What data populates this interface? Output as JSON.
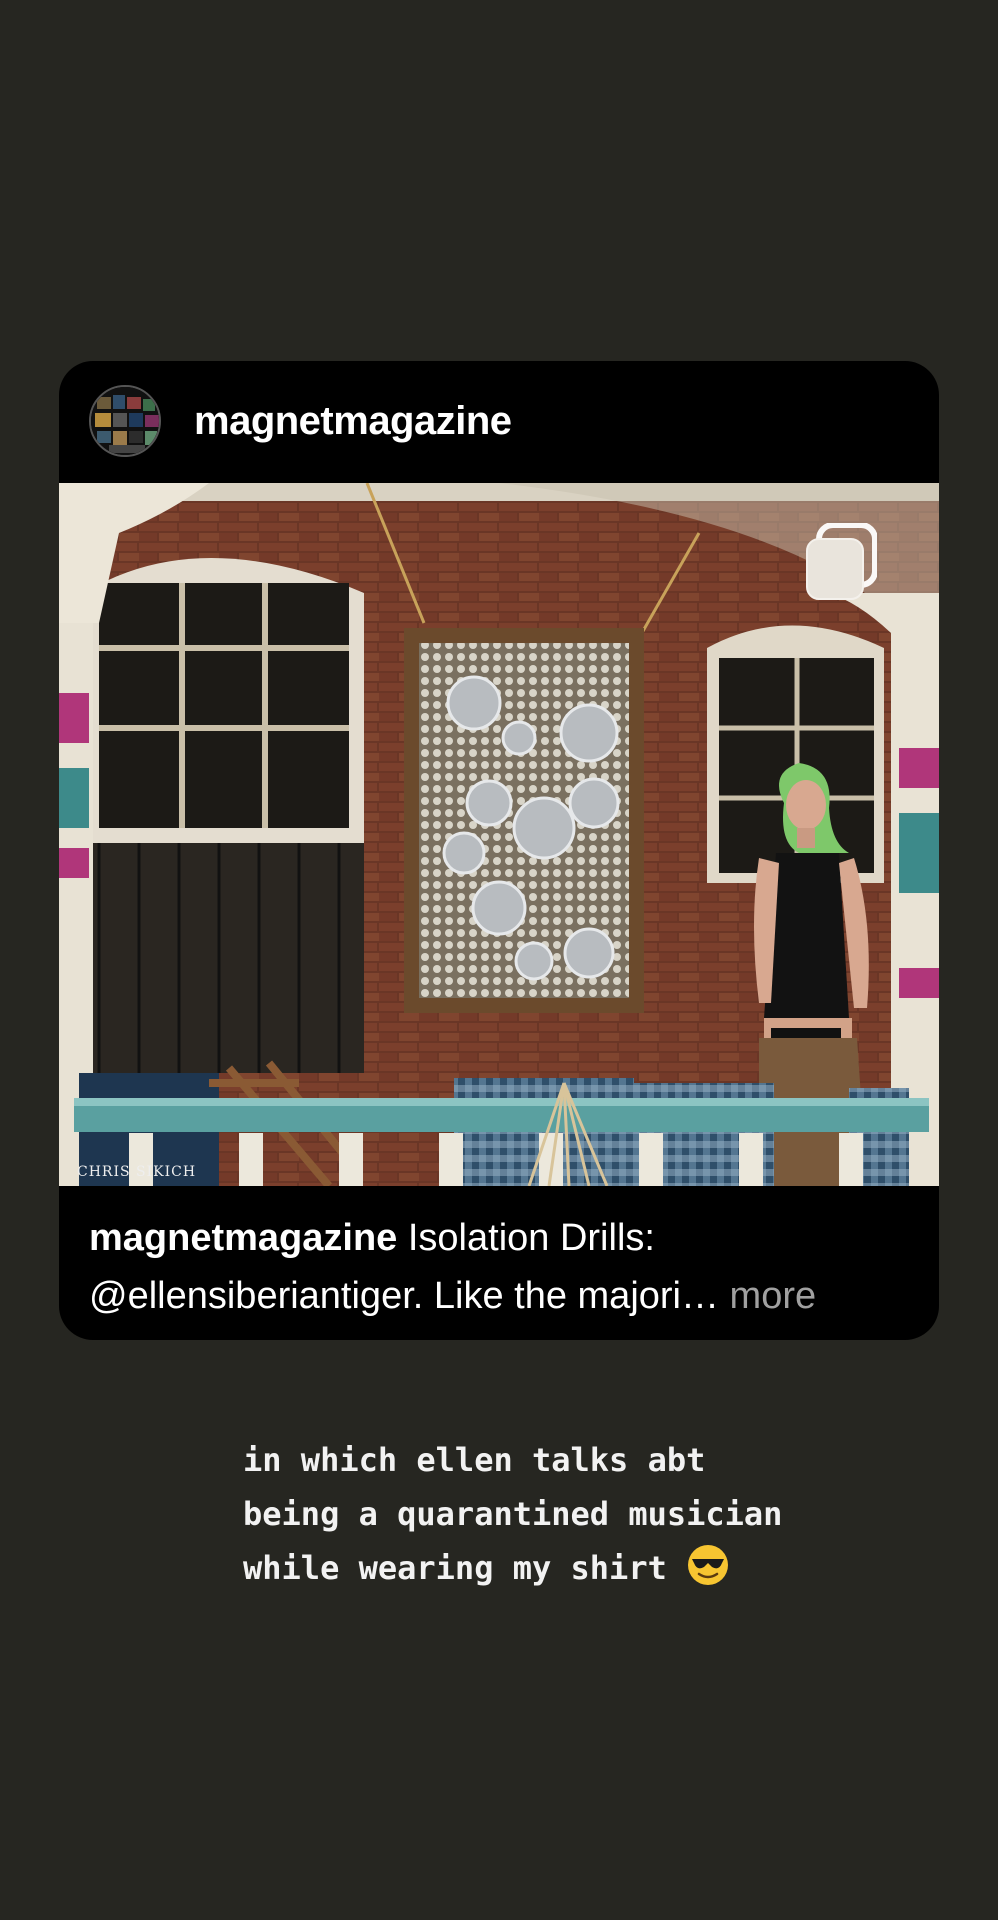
{
  "post": {
    "username": "magnetmagazine",
    "photo_credit": "CHRIS SIKICH",
    "caption_user": "magnetmagazine",
    "caption_text": " Isolation Drills: @ellensiberiantiger. Like the majori",
    "caption_ellipsis": "…",
    "caption_more": " more",
    "icons": {
      "avatar": "magazine-collage-avatar",
      "multi": "multiple-posts-icon"
    }
  },
  "story_text": {
    "line1": "in which ellen talks abt",
    "line2": "being a quarantined musician",
    "line3": "while wearing my shirt",
    "emoji": "smiling-face-with-sunglasses"
  },
  "colors": {
    "background": "#262621",
    "card": "#000000",
    "more": "#a0a0a0"
  }
}
